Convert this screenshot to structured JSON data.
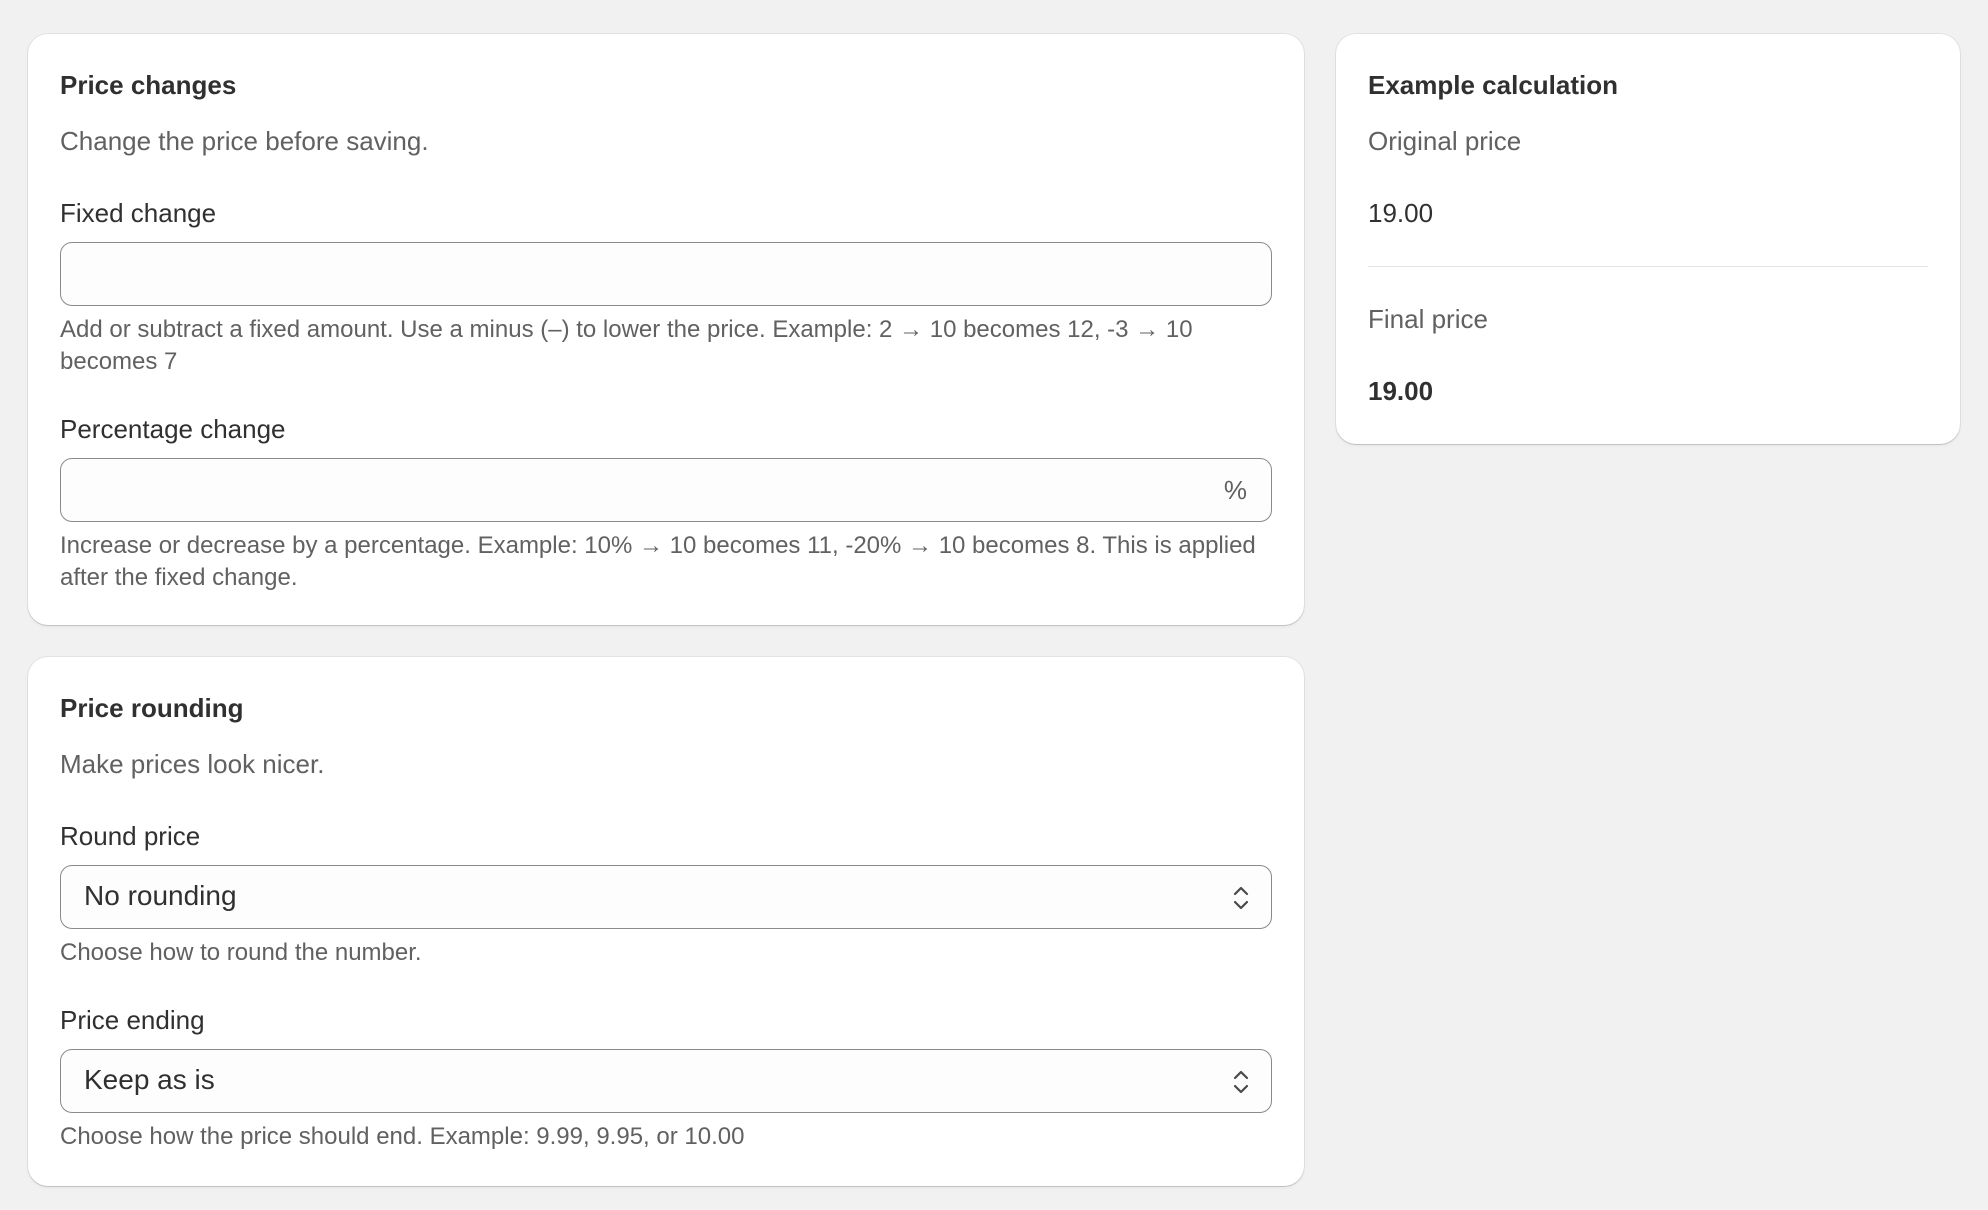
{
  "price_changes": {
    "title": "Price changes",
    "description": "Change the price before saving.",
    "fixed_change": {
      "label": "Fixed change",
      "value": "",
      "help": "Add or subtract a fixed amount. Use a minus (–) to lower the price. Example: 2 → 10 becomes 12, -3 → 10 becomes 7"
    },
    "percentage_change": {
      "label": "Percentage change",
      "value": "",
      "suffix": "%",
      "help": "Increase or decrease by a percentage. Example: 10% → 10 becomes 11, -20% → 10 becomes 8. This is applied after the fixed change."
    }
  },
  "price_rounding": {
    "title": "Price rounding",
    "description": "Make prices look nicer.",
    "round_price": {
      "label": "Round price",
      "selected": "No rounding",
      "help": "Choose how to round the number."
    },
    "price_ending": {
      "label": "Price ending",
      "selected": "Keep as is",
      "help": "Choose how the price should end. Example: 9.99, 9.95, or 10.00"
    }
  },
  "example_calculation": {
    "title": "Example calculation",
    "original_label": "Original price",
    "original_value": "19.00",
    "final_label": "Final price",
    "final_value": "19.00"
  },
  "icons": {
    "select_chevron": "chevron-up-down-icon"
  }
}
